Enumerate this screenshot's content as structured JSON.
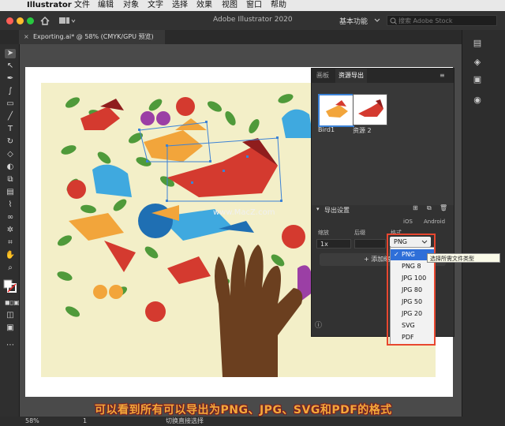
{
  "menubar": {
    "app": "Illustrator",
    "items": [
      "文件",
      "编辑",
      "对象",
      "文字",
      "选择",
      "效果",
      "视图",
      "窗口",
      "帮助"
    ]
  },
  "titlebar": {
    "title": "Adobe Illustrator 2020",
    "workspace": "基本功能",
    "stock_placeholder": "搜索 Adobe Stock"
  },
  "document_tab": {
    "label": "Exporting.ai* @ 58% (CMYK/GPU 预览)"
  },
  "panel": {
    "tabs": [
      "画板",
      "资源导出"
    ],
    "assets": [
      {
        "label": "Bird1"
      },
      {
        "label": "资源 2"
      }
    ],
    "export_settings_label": "导出设置",
    "platforms": [
      "iOS",
      "Android"
    ],
    "columns": [
      "缩放",
      "后缀",
      "格式"
    ],
    "scale_value": "1x",
    "add_label": "添加缩"
  },
  "format_select": {
    "value": "PNG"
  },
  "format_menu": {
    "options": [
      "PNG",
      "PNG 8",
      "JPG 100",
      "JPG 80",
      "JPG 50",
      "JPG 20",
      "SVG",
      "PDF"
    ],
    "selected_index": 0
  },
  "tooltip": "选择所需文件类型",
  "watermark": "www.MacZ.com",
  "status": {
    "zoom": "58%",
    "page": "1",
    "tool_hint": "切换直接选择"
  },
  "caption": "可以看到所有可以导出为PNG、JPG、SVG和PDF的格式",
  "colors": {
    "highlight": "#e8472f",
    "caption": "#f2a93b",
    "selection": "#3b82d6"
  }
}
